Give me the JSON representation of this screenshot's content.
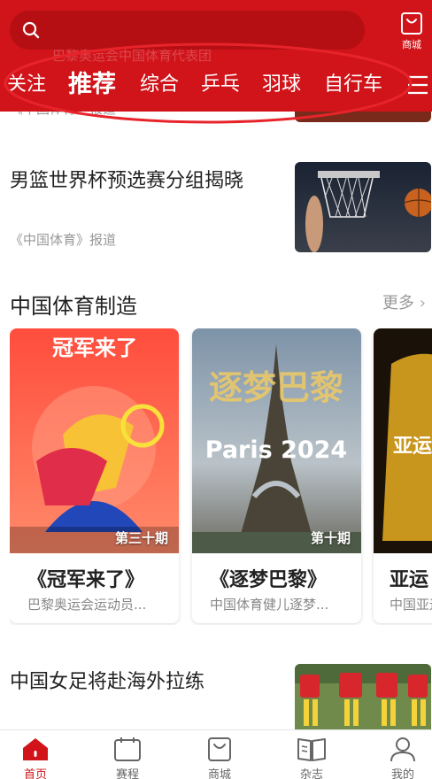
{
  "header": {
    "search_placeholder": "巴黎奥运会中国体育代表团",
    "mall_label": "商城"
  },
  "tabs": [
    "关注",
    "推荐",
    "综合",
    "乒乓",
    "羽球",
    "自行车"
  ],
  "peek_item": {
    "source": "《中国体育》报道"
  },
  "news": [
    {
      "title": "男篮世界杯预选赛分组揭晓",
      "source": "《中国体育》报道"
    },
    {
      "title": "中国女足将赴海外拉练"
    }
  ],
  "section": {
    "title": "中国体育制造",
    "more": "更多"
  },
  "cards": [
    {
      "cover_text": "冠军来了",
      "issue": "第三十期",
      "title": "《冠军来了》",
      "desc": "巴黎奥运会运动员..."
    },
    {
      "cover_text": "逐梦巴黎",
      "cover_sub": "Paris 2024",
      "issue": "第十期",
      "title": "《逐梦巴黎》",
      "desc": "中国体育健儿逐梦..."
    },
    {
      "cover_text": "亚运",
      "title": "亚运",
      "desc": "中国亚运"
    }
  ],
  "bottom_nav": [
    {
      "label": "首页",
      "icon": "home-icon",
      "active": true
    },
    {
      "label": "赛程",
      "icon": "schedule-icon",
      "active": false
    },
    {
      "label": "商城",
      "icon": "mall-icon",
      "active": false
    },
    {
      "label": "杂志",
      "icon": "magazine-icon",
      "active": false
    },
    {
      "label": "我的",
      "icon": "profile-icon",
      "active": false
    }
  ],
  "colors": {
    "brand_red": "#d0141a",
    "text": "#222222",
    "muted": "#999999"
  }
}
